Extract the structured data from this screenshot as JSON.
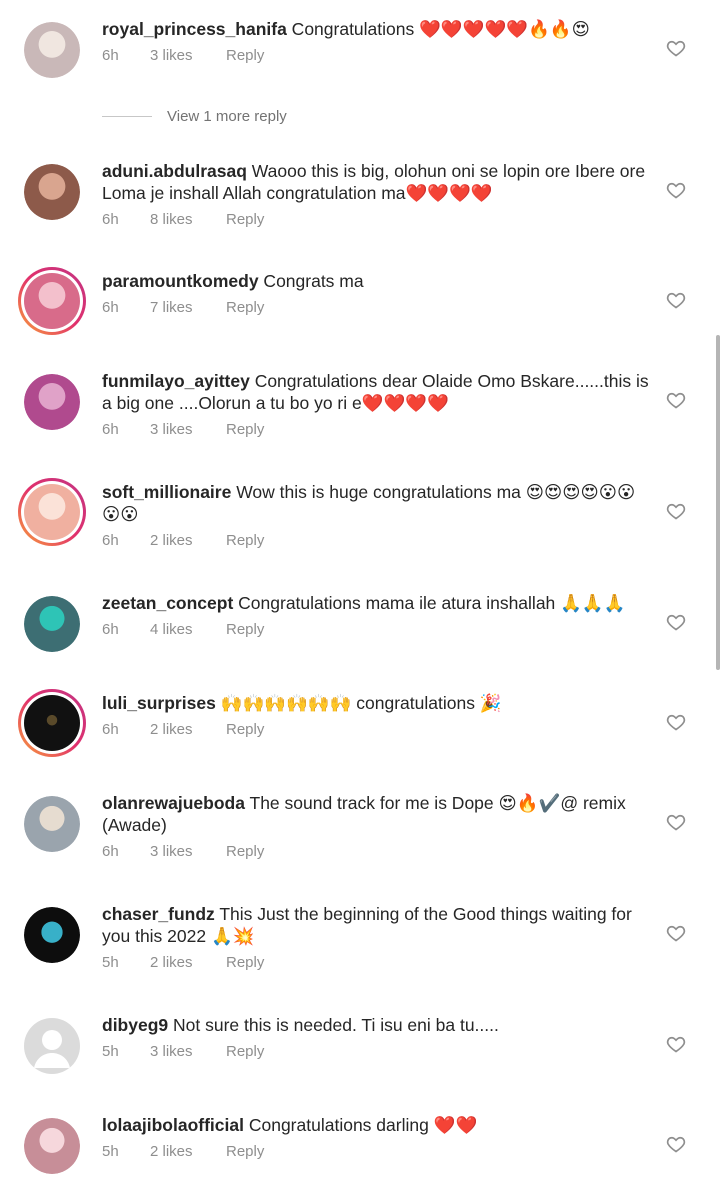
{
  "comments": [
    {
      "user": "royal_princess_hanifa",
      "text": " Congratulations ❤️❤️❤️❤️❤️🔥🔥😍",
      "time": "6h",
      "likes": "3 likes",
      "reply": "Reply",
      "avatar_color": "#c9b8b8"
    },
    {
      "user": "aduni.abdulrasaq",
      "text": " Waooo this is big, olohun oni se lopin ore Ibere ore Loma je inshall Allah congratulation ma❤️❤️❤️❤️",
      "time": "6h",
      "likes": "8 likes",
      "reply": "Reply",
      "avatar_color": "#8d5a4a"
    },
    {
      "user": "paramountkomedy",
      "text": " Congrats ma",
      "time": "6h",
      "likes": "7 likes",
      "reply": "Reply",
      "avatar_color": "#d86b8a"
    },
    {
      "user": "funmilayo_ayittey",
      "text": " Congratulations dear Olaide Omo Bskare......this is a big one ....Olorun a tu bo yo ri e❤️❤️❤️❤️",
      "time": "6h",
      "likes": "3 likes",
      "reply": "Reply",
      "avatar_color": "#b04a8e"
    },
    {
      "user": "soft_millionaire",
      "text": " Wow this is huge congratulations ma 😍😍😍😍😮😮😮😮",
      "time": "6h",
      "likes": "2 likes",
      "reply": "Reply",
      "avatar_color": "#f0b0a0"
    },
    {
      "user": "zeetan_concept",
      "text": " Congratulations mama ile atura inshallah 🙏🙏🙏",
      "time": "6h",
      "likes": "4 likes",
      "reply": "Reply",
      "avatar_color": "#3d6e73"
    },
    {
      "user": "luli_surprises",
      "text": " 🙌🙌🙌🙌🙌🙌 congratulations 🎉",
      "time": "6h",
      "likes": "2 likes",
      "reply": "Reply",
      "avatar_color": "#111111"
    },
    {
      "user": "olanrewajueboda",
      "text": " The sound track for me is Dope 😍🔥✔️@ remix (Awade)",
      "time": "6h",
      "likes": "3 likes",
      "reply": "Reply",
      "avatar_color": "#9aa4ad"
    },
    {
      "user": "chaser_fundz",
      "text": " This Just the beginning of the Good things waiting for you this 2022 🙏💥",
      "time": "5h",
      "likes": "2 likes",
      "reply": "Reply",
      "avatar_color": "#0d0d0d"
    },
    {
      "user": "dibyeg9",
      "text": " Not sure this is needed. Ti isu eni ba tu.....",
      "time": "5h",
      "likes": "3 likes",
      "reply": "Reply",
      "avatar_color": "#dbdbdb"
    },
    {
      "user": "lolaajibolaofficial",
      "text": " Congratulations darling ❤️❤️",
      "time": "5h",
      "likes": "2 likes",
      "reply": "Reply",
      "avatar_color": "#c78e98"
    }
  ],
  "view_more": "View 1 more reply",
  "colors": {
    "secondary_text": "#8e8e8e",
    "primary_text": "#262626",
    "heart_outline": "#8e8e8e"
  }
}
